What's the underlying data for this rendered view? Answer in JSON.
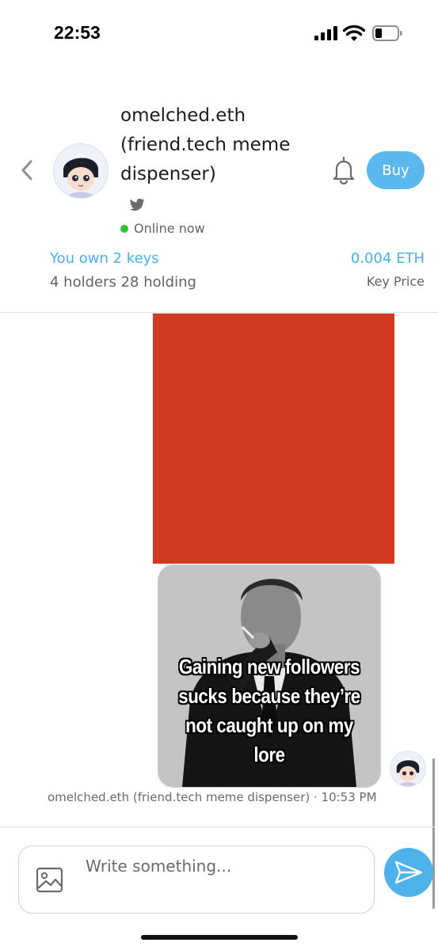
{
  "status_bar": {
    "time": "22:53"
  },
  "header": {
    "name": "omelched.eth (friend.tech meme dispenser)",
    "status": "Online now",
    "buy_label": "Buy",
    "keys_owned": "You own 2 keys",
    "holders_holding": "4 holders  28 holding",
    "key_price": "0.004 ETH",
    "key_price_label": "Key Price"
  },
  "colors": {
    "accent": "#5ab8ee",
    "online": "#2fc52f",
    "red_image": "#d03a20"
  },
  "icons": [
    "chevron-left-icon",
    "twitter-icon",
    "bell-icon",
    "image-icon",
    "send-icon",
    "signal-icon",
    "wifi-icon",
    "battery-icon"
  ],
  "messages": [
    {
      "meme_caption": "Gaining new followers sucks because they’re not caught up on my lore",
      "meta": "omelched.eth (friend.tech meme dispenser) · 10:53 PM"
    }
  ],
  "composer": {
    "placeholder": "Write something..."
  }
}
